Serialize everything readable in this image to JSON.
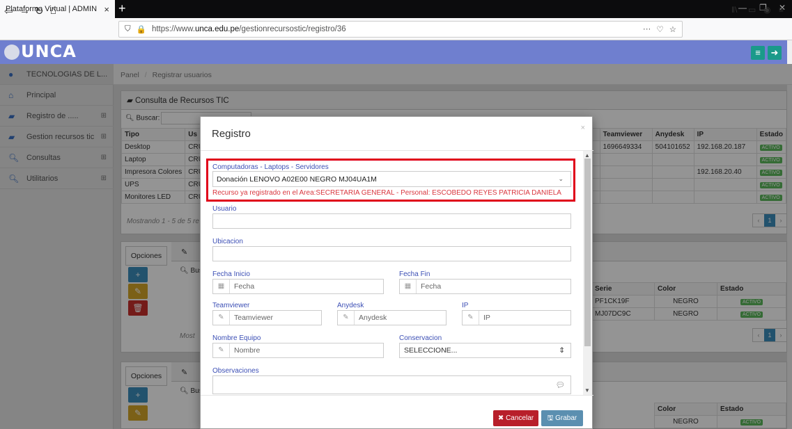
{
  "browser": {
    "tab_title": "Plataforma Virtual | ADMIN",
    "tab_close": "×",
    "new_tab": "+",
    "url_prefix": "https://www.",
    "url_domain": "unca.edu.pe",
    "url_path": "/gestionrecursostic/registro/36",
    "url_more": "···"
  },
  "app": {
    "logo_text": "UNCA"
  },
  "sidebar": {
    "items": [
      {
        "label": "TECNOLOGIAS DE L...",
        "icon": "user-icon"
      },
      {
        "label": "Principal",
        "icon": "home-icon"
      },
      {
        "label": "Registro de .....",
        "icon": "book-icon",
        "expand": "⊞"
      },
      {
        "label": "Gestion recursos tic",
        "icon": "book-icon",
        "expand": "⊞"
      },
      {
        "label": "Consultas",
        "icon": "search-icon",
        "expand": "⊞"
      },
      {
        "label": "Utilitarios",
        "icon": "search-icon",
        "expand": "⊞"
      }
    ]
  },
  "breadcrumb": {
    "panel": "Panel",
    "sep": "/",
    "current": "Registrar usuarios"
  },
  "consulta_panel": {
    "title": "Consulta de Recursos TIC",
    "search_label": "Buscar:",
    "columns": [
      "Tipo",
      "Us",
      "Teamviewer",
      "Anydesk",
      "IP",
      "Estado"
    ],
    "rows": [
      {
        "tipo": "Desktop",
        "us": "CRU",
        "teamviewer": "1696649334",
        "anydesk": "504101652",
        "ip": "192.168.20.187",
        "estado": "ACTIVO"
      },
      {
        "tipo": "Laptop",
        "us": "CRU",
        "teamviewer": "",
        "anydesk": "",
        "ip": "",
        "estado": "ACTIVO"
      },
      {
        "tipo": "Impresora Colores",
        "us": "CRU",
        "teamviewer": "",
        "anydesk": "",
        "ip": "192.168.20.40",
        "estado": "ACTIVO"
      },
      {
        "tipo": "UPS",
        "us": "CRU",
        "teamviewer": "",
        "anydesk": "",
        "ip": "",
        "estado": "ACTIVO"
      },
      {
        "tipo": "Monitores LED",
        "us": "CRU",
        "teamviewer": "",
        "anydesk": "",
        "ip": "",
        "estado": "ACTIVO"
      }
    ],
    "showing": "Mostrando 1 - 5 de 5 re",
    "page": "1"
  },
  "opciones_panel_1": {
    "label": "Opciones",
    "search_label": "Bus",
    "columns": [
      "Serie",
      "Color",
      "Estado"
    ],
    "rows": [
      {
        "serie": "PF1CK19F",
        "color": "NEGRO",
        "estado": "ACTIVO"
      },
      {
        "serie": "MJ07DC9C",
        "color": "NEGRO",
        "estado": "ACTIVO"
      }
    ],
    "showing": "Most",
    "page": "1"
  },
  "opciones_panel_2": {
    "label": "Opciones",
    "search_label": "Bus",
    "columns": [
      "Color",
      "Estado"
    ],
    "rows": [
      {
        "color": "NEGRO",
        "estado": "ACTIVO"
      }
    ]
  },
  "modal": {
    "title": "Registro",
    "close": "×",
    "computadoras_label": "Computadoras - Laptops - Servidores",
    "computadoras_value": "Donación LENOVO A02E00 NEGRO MJ04UA1M",
    "error_message": "Recurso ya registrado en el Area:SECRETARIA GENERAL - Personal: ESCOBEDO REYES PATRICIA DANIELA",
    "usuario_label": "Usuario",
    "ubicacion_label": "Ubicacion",
    "fecha_inicio_label": "Fecha Inicio",
    "fecha_fin_label": "Fecha Fin",
    "fecha_placeholder": "Fecha",
    "teamviewer_label": "Teamviewer",
    "teamviewer_placeholder": "Teamviewer",
    "anydesk_label": "Anydesk",
    "anydesk_placeholder": "Anydesk",
    "ip_label": "IP",
    "ip_placeholder": "IP",
    "nombre_label": "Nombre Equipo",
    "nombre_placeholder": "Nombre",
    "conservacion_label": "Conservacion",
    "conservacion_value": "SELECCIONE...",
    "observaciones_label": "Observaciones",
    "cancel_label": "Cancelar",
    "save_label": "Grabar"
  },
  "colors": {
    "header": "#6f7fcf",
    "error": "#d9363e",
    "cancel": "#b81f2a",
    "save": "#5b8fb0",
    "active_badge": "#5cb85c"
  }
}
